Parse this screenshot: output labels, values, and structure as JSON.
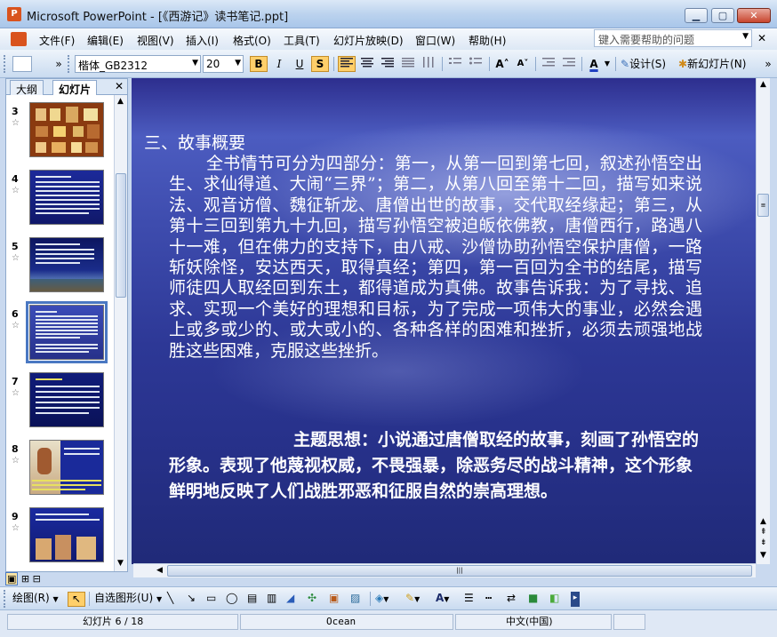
{
  "window": {
    "app_icon_letter": "P",
    "title": "Microsoft PowerPoint - [《西游记》读书笔记.ppt]",
    "minimize_glyph": "▁",
    "maximize_glyph": "▢",
    "close_glyph": "✕"
  },
  "menu": {
    "items": [
      "文件(F)",
      "编辑(E)",
      "视图(V)",
      "插入(I)",
      "格式(O)",
      "工具(T)",
      "幻灯片放映(D)",
      "窗口(W)",
      "帮助(H)"
    ],
    "help_placeholder": "键入需要帮助的问题",
    "close_glyph": "✕"
  },
  "toolbar": {
    "font_name": "楷体_GB2312",
    "font_size": "20",
    "bold": "B",
    "italic": "I",
    "underline": "U",
    "shadow": "S",
    "increase_font": "A˄",
    "decrease_font": "A˅",
    "design_label": "设计(S)",
    "new_slide_label": "新幻灯片(N)",
    "font_color_glyph": "A",
    "overflow": "»"
  },
  "left_pane": {
    "tabs": [
      "大纲",
      "幻灯片"
    ],
    "active_tab": "幻灯片",
    "close_glyph": "✕",
    "thumbnails": [
      {
        "num": "3",
        "star": "☆"
      },
      {
        "num": "4",
        "star": "☆"
      },
      {
        "num": "5",
        "star": "☆"
      },
      {
        "num": "6",
        "star": "☆"
      },
      {
        "num": "7",
        "star": "☆"
      },
      {
        "num": "8",
        "star": "☆"
      },
      {
        "num": "9",
        "star": "☆"
      }
    ],
    "selected_slide": "6"
  },
  "slide": {
    "heading": "三、故事概要",
    "body": "全书情节可分为四部分：第一，从第一回到第七回，叙述孙悟空出生、求仙得道、大闹“三界”；第二，从第八回至第十二回，描写如来说法、观音访僧、魏征斩龙、唐僧出世的故事，交代取经缘起；第三，从第十三回到第九十九回，描写孙悟空被迫皈依佛教，唐僧西行，路遇八十一难，但在佛力的支持下，由八戒、沙僧协助孙悟空保护唐僧，一路斩妖除怪，安达西天，取得真经；第四，第一百回为全书的结尾，描写师徒四人取经回到东土，都得道成为真佛。故事告诉我：为了寻找、追求、实现一个美好的理想和目标，为了完成一项伟大的事业，必然会遇上或多或少的、或大或小的、各种各样的困难和挫折，必须去顽强地战胜这些困难，克服这些挫折。",
    "theme": "主题思想：小说通过唐僧取经的故事，刻画了孙悟空的形象。表现了他蔑视权威，不畏强暴，除恶务尽的战斗精神，这个形象鲜明地反映了人们战胜邪恶和征服自然的崇高理想。"
  },
  "draw_toolbar": {
    "draw_label": "绘图(R)",
    "autoshapes_label": "自选图形(U)"
  },
  "status": {
    "slide_pos": "幻灯片 6 / 18",
    "design": "Ocean",
    "language": "中文(中国)"
  },
  "colors": {
    "slide_bg": "#2d3896",
    "selection": "#4a78c2",
    "title_bar": "#a9c6ea"
  }
}
